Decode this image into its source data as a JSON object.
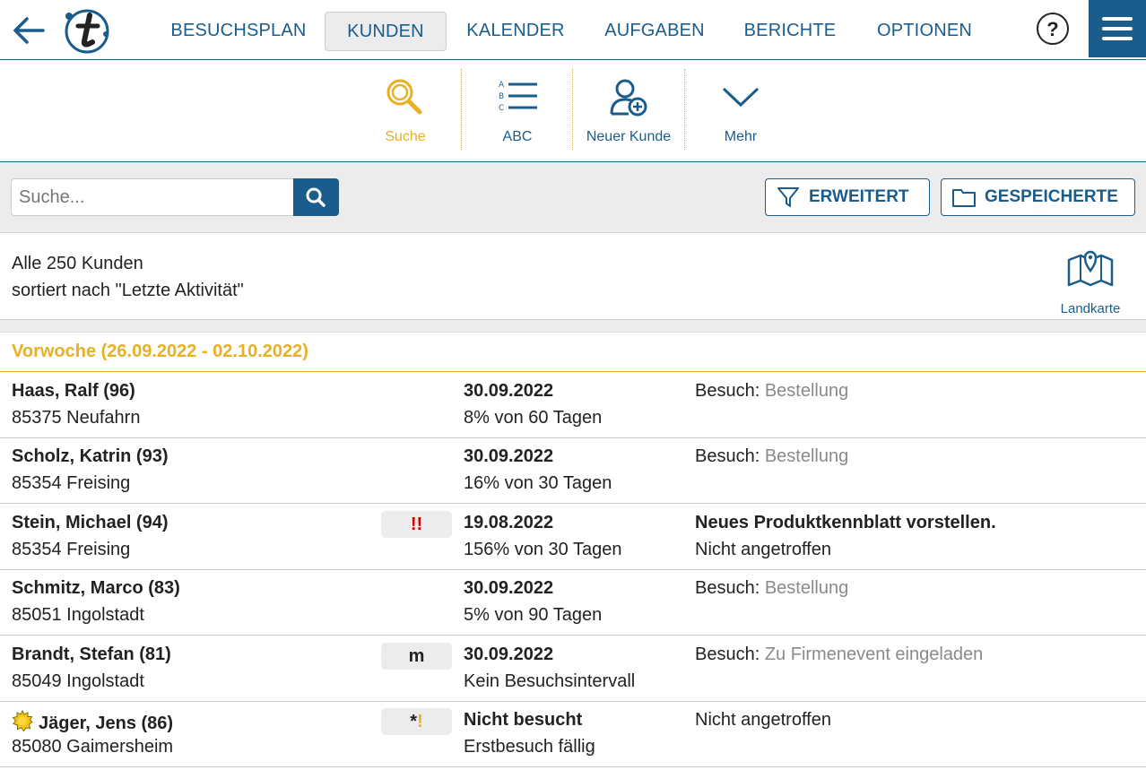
{
  "nav": {
    "tabs": [
      "BESUCHSPLAN",
      "KUNDEN",
      "KALENDER",
      "AUFGABEN",
      "BERICHTE",
      "OPTIONEN"
    ],
    "active_tab": "KUNDEN",
    "help_label": "?"
  },
  "toolbar": {
    "items": [
      {
        "label": "Suche",
        "icon": "magnifier-icon",
        "active": true
      },
      {
        "label": "ABC",
        "icon": "abc-list-icon",
        "active": false
      },
      {
        "label": "Neuer Kunde",
        "icon": "add-person-icon",
        "active": false
      },
      {
        "label": "Mehr",
        "icon": "chevron-down-icon",
        "active": false
      }
    ]
  },
  "search": {
    "placeholder": "Suche...",
    "extended_label": "ERWEITERT",
    "saved_label": "GESPEICHERTE"
  },
  "summary": {
    "count_text": "Alle 250 Kunden",
    "sort_text": "sortiert nach \"Letzte Aktivität\"",
    "map_label": "Landkarte"
  },
  "week": {
    "label": "Vorwoche (26.09.2022 - 02.10.2022)"
  },
  "customers": [
    {
      "name": "Haas, Ralf (96)",
      "city": "85375 Neufahrn",
      "badge": "",
      "date": "30.09.2022",
      "interval": "8% von 60 Tagen",
      "activity_prefix": "Besuch:",
      "activity_detail": "Bestellung",
      "activity_line2": ""
    },
    {
      "name": "Scholz, Katrin (93)",
      "city": "85354 Freising",
      "badge": "",
      "date": "30.09.2022",
      "interval": "16% von 30 Tagen",
      "activity_prefix": "Besuch:",
      "activity_detail": "Bestellung",
      "activity_line2": ""
    },
    {
      "name": "Stein, Michael (94)",
      "city": "85354 Freising",
      "badge": "!!",
      "date": "19.08.2022",
      "interval": "156% von 30 Tagen",
      "activity_prefix": "Neues Produktkennblatt vorstellen.",
      "activity_detail": "",
      "activity_line2": "Nicht angetroffen"
    },
    {
      "name": "Schmitz, Marco (83)",
      "city": "85051 Ingolstadt",
      "badge": "",
      "date": "30.09.2022",
      "interval": "5% von 90 Tagen",
      "activity_prefix": "Besuch:",
      "activity_detail": "Bestellung",
      "activity_line2": ""
    },
    {
      "name": "Brandt, Stefan (81)",
      "city": "85049 Ingolstadt",
      "badge": "m",
      "date": "30.09.2022",
      "interval": "Kein Besuchsintervall",
      "activity_prefix": "Besuch:",
      "activity_detail": "Zu Firmenevent eingeladen",
      "activity_line2": ""
    },
    {
      "name": "Jäger, Jens (86)",
      "city": "85080 Gaimersheim",
      "badge": "*!",
      "date": "Nicht besucht",
      "interval": "Erstbesuch fällig",
      "activity_prefix": "Nicht angetroffen",
      "activity_detail": "",
      "activity_line2": ""
    }
  ],
  "colors": {
    "brand": "#1a5d8d",
    "accent": "#e8b024",
    "alert": "#d40000"
  }
}
